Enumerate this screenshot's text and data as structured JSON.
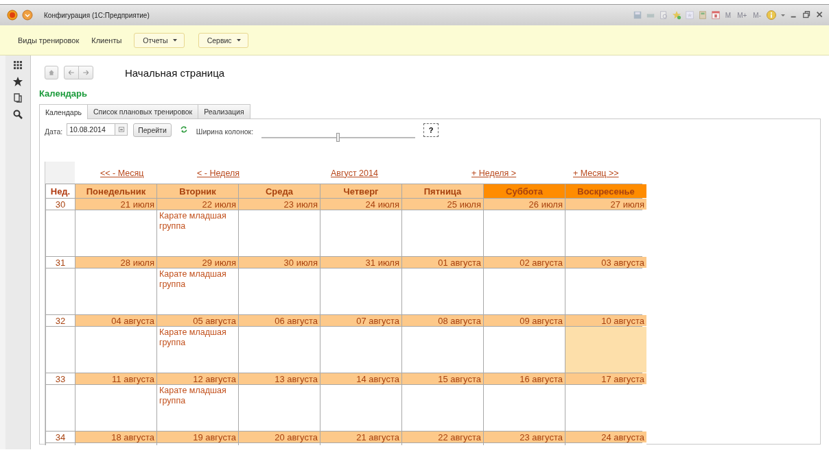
{
  "window": {
    "title": "Конфигурация  (1С:Предприятие)",
    "memory_buttons": [
      "M",
      "M+",
      "M-"
    ]
  },
  "menu": [
    {
      "label": "Виды тренировок",
      "kind": "link"
    },
    {
      "label": "Клиенты",
      "kind": "link"
    },
    {
      "label": "Отчеты",
      "kind": "dropdown"
    },
    {
      "label": "Сервис",
      "kind": "dropdown"
    }
  ],
  "page": {
    "title": "Начальная страница",
    "form_title": "Календарь"
  },
  "tabs": [
    {
      "label": "Календарь",
      "selected": true
    },
    {
      "label": "Список плановых тренировок",
      "selected": false
    },
    {
      "label": "Реализация",
      "selected": false
    }
  ],
  "filter": {
    "date_label": "Дата:",
    "date_value": "10.08.2014",
    "go_button": "Перейти",
    "width_label": "Ширина колонок:",
    "width_slider": {
      "level": 0.5
    },
    "help_button": "?"
  },
  "calendar": {
    "nav": [
      "<< - Месяц",
      "< - Неделя",
      "Август 2014",
      "+ Неделя >",
      "+ Месяц >>"
    ],
    "week_header": "Нед.",
    "weekdays": [
      {
        "label": "Понедельник",
        "weekend": false
      },
      {
        "label": "Вторник",
        "weekend": false
      },
      {
        "label": "Среда",
        "weekend": false
      },
      {
        "label": "Четверг",
        "weekend": false
      },
      {
        "label": "Пятница",
        "weekend": false
      },
      {
        "label": "Суббота",
        "weekend": true
      },
      {
        "label": "Воскресенье",
        "weekend": true
      }
    ],
    "weeks": [
      {
        "number": "30",
        "days": [
          {
            "date": "21 июля",
            "selected": false
          },
          {
            "date": "22 июля",
            "selected": false,
            "event": "Карате младшая группа"
          },
          {
            "date": "23 июля",
            "selected": false
          },
          {
            "date": "24 июля",
            "selected": false
          },
          {
            "date": "25 июля",
            "selected": false
          },
          {
            "date": "26 июля",
            "selected": false
          },
          {
            "date": "27 июля",
            "selected": false
          }
        ]
      },
      {
        "number": "31",
        "days": [
          {
            "date": "28 июля",
            "selected": false
          },
          {
            "date": "29 июля",
            "selected": false,
            "event": "Карате младшая группа"
          },
          {
            "date": "30 июля",
            "selected": false
          },
          {
            "date": "31 июля",
            "selected": false
          },
          {
            "date": "01 августа",
            "selected": false
          },
          {
            "date": "02 августа",
            "selected": false
          },
          {
            "date": "03 августа",
            "selected": false
          }
        ]
      },
      {
        "number": "32",
        "days": [
          {
            "date": "04 августа",
            "selected": false
          },
          {
            "date": "05 августа",
            "selected": false,
            "event": "Карате младшая группа"
          },
          {
            "date": "06 августа",
            "selected": false
          },
          {
            "date": "07 августа",
            "selected": false
          },
          {
            "date": "08 августа",
            "selected": false
          },
          {
            "date": "09 августа",
            "selected": false
          },
          {
            "date": "10 августа",
            "selected": true
          }
        ]
      },
      {
        "number": "33",
        "days": [
          {
            "date": "11 августа",
            "selected": false
          },
          {
            "date": "12 августа",
            "selected": false,
            "event": "Карате младшая группа"
          },
          {
            "date": "13 августа",
            "selected": false
          },
          {
            "date": "14 августа",
            "selected": false
          },
          {
            "date": "15 августа",
            "selected": false
          },
          {
            "date": "16 августа",
            "selected": false
          },
          {
            "date": "17 августа",
            "selected": false
          }
        ]
      },
      {
        "number": "34",
        "days": [
          {
            "date": "18 августа",
            "selected": false
          },
          {
            "date": "19 августа",
            "selected": false
          },
          {
            "date": "20 августа",
            "selected": false
          },
          {
            "date": "21 августа",
            "selected": false
          },
          {
            "date": "22 августа",
            "selected": false
          },
          {
            "date": "23 августа",
            "selected": false
          },
          {
            "date": "24 августа",
            "selected": false
          }
        ]
      }
    ]
  }
}
